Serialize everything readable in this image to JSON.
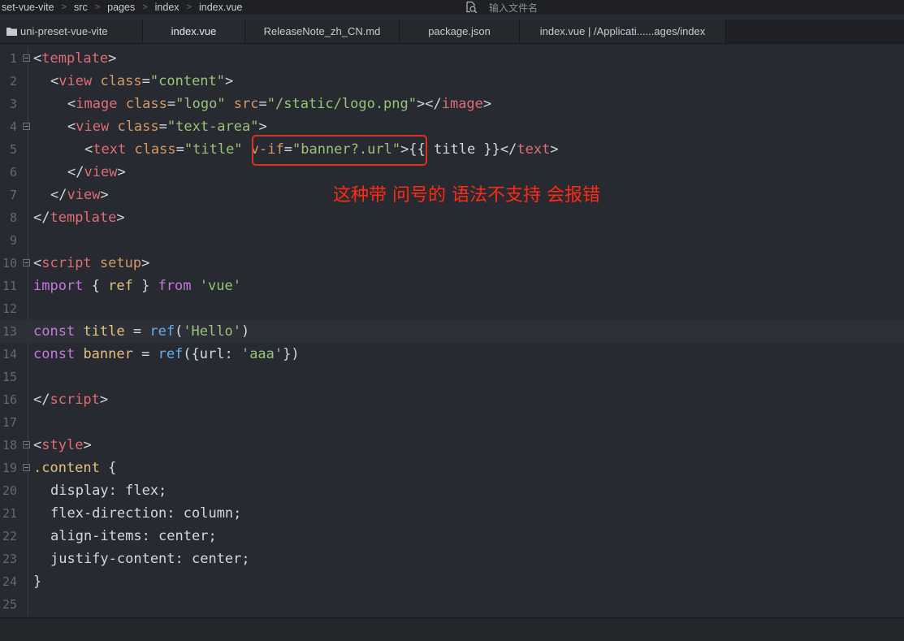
{
  "breadcrumb": [
    "set-vue-vite",
    "src",
    "pages",
    "index",
    "index.vue"
  ],
  "breadcrumb_separator": ">",
  "search": {
    "placeholder": "输入文件名"
  },
  "tabs": [
    {
      "label": "uni-preset-vue-vite",
      "active": false
    },
    {
      "label": "index.vue",
      "active": true
    },
    {
      "label": "ReleaseNote_zh_CN.md",
      "active": false
    },
    {
      "label": "package.json",
      "active": false
    },
    {
      "label": "index.vue | /Applicati......ages/index",
      "active": false
    }
  ],
  "lines": [
    {
      "n": "1",
      "fold": true,
      "indent": 0,
      "tokens": [
        [
          "p",
          "<"
        ],
        [
          "t",
          "template"
        ],
        [
          "p",
          ">"
        ]
      ]
    },
    {
      "n": "2",
      "fold": false,
      "indent": 1,
      "tokens": [
        [
          "p",
          "<"
        ],
        [
          "t",
          "view"
        ],
        [
          "p",
          " "
        ],
        [
          "a",
          "class"
        ],
        [
          "p",
          "="
        ],
        [
          "s",
          "\"content\""
        ],
        [
          "p",
          ">"
        ]
      ]
    },
    {
      "n": "3",
      "fold": false,
      "indent": 2,
      "tokens": [
        [
          "p",
          "<"
        ],
        [
          "t",
          "image"
        ],
        [
          "p",
          " "
        ],
        [
          "a",
          "class"
        ],
        [
          "p",
          "="
        ],
        [
          "s",
          "\"logo\""
        ],
        [
          "p",
          " "
        ],
        [
          "a",
          "src"
        ],
        [
          "p",
          "="
        ],
        [
          "s",
          "\"/static/logo.png\""
        ],
        [
          "p",
          "></"
        ],
        [
          "t",
          "image"
        ],
        [
          "p",
          ">"
        ]
      ]
    },
    {
      "n": "4",
      "fold": true,
      "indent": 2,
      "tokens": [
        [
          "p",
          "<"
        ],
        [
          "t",
          "view"
        ],
        [
          "p",
          " "
        ],
        [
          "a",
          "class"
        ],
        [
          "p",
          "="
        ],
        [
          "s",
          "\"text-area\""
        ],
        [
          "p",
          ">"
        ]
      ]
    },
    {
      "n": "5",
      "fold": false,
      "indent": 3,
      "tokens": [
        [
          "p",
          "<"
        ],
        [
          "t",
          "text"
        ],
        [
          "p",
          " "
        ],
        [
          "a",
          "class"
        ],
        [
          "p",
          "="
        ],
        [
          "s",
          "\"title\""
        ],
        [
          "p",
          " "
        ],
        [
          "a",
          "v-if"
        ],
        [
          "p",
          "="
        ],
        [
          "s",
          "\"banner?.url\""
        ],
        [
          "p",
          ">{{ title }}</"
        ],
        [
          "t",
          "text"
        ],
        [
          "p",
          ">"
        ]
      ]
    },
    {
      "n": "6",
      "fold": false,
      "indent": 2,
      "tokens": [
        [
          "p",
          "</"
        ],
        [
          "t",
          "view"
        ],
        [
          "p",
          ">"
        ]
      ]
    },
    {
      "n": "7",
      "fold": false,
      "indent": 1,
      "tokens": [
        [
          "p",
          "</"
        ],
        [
          "t",
          "view"
        ],
        [
          "p",
          ">"
        ]
      ]
    },
    {
      "n": "8",
      "fold": false,
      "indent": 0,
      "tokens": [
        [
          "p",
          "</"
        ],
        [
          "t",
          "template"
        ],
        [
          "p",
          ">"
        ]
      ]
    },
    {
      "n": "9",
      "fold": false,
      "indent": 0,
      "tokens": []
    },
    {
      "n": "10",
      "fold": true,
      "indent": 0,
      "tokens": [
        [
          "p",
          "<"
        ],
        [
          "t",
          "script"
        ],
        [
          "p",
          " "
        ],
        [
          "a",
          "setup"
        ],
        [
          "p",
          ">"
        ]
      ]
    },
    {
      "n": "11",
      "fold": false,
      "indent": 0,
      "tokens": [
        [
          "k",
          "import"
        ],
        [
          "p",
          " { "
        ],
        [
          "v",
          "ref"
        ],
        [
          "p",
          " } "
        ],
        [
          "k",
          "from"
        ],
        [
          "p",
          " "
        ],
        [
          "s",
          "'vue'"
        ]
      ]
    },
    {
      "n": "12",
      "fold": false,
      "indent": 0,
      "tokens": []
    },
    {
      "n": "13",
      "fold": false,
      "indent": 0,
      "current": true,
      "tokens": [
        [
          "k",
          "const"
        ],
        [
          "p",
          " "
        ],
        [
          "v",
          "title"
        ],
        [
          "p",
          " = "
        ],
        [
          "f",
          "ref"
        ],
        [
          "p",
          "("
        ],
        [
          "s",
          "'Hello'"
        ],
        [
          "p",
          ")"
        ]
      ]
    },
    {
      "n": "14",
      "fold": false,
      "indent": 0,
      "tokens": [
        [
          "k",
          "const"
        ],
        [
          "p",
          " "
        ],
        [
          "v",
          "banner"
        ],
        [
          "p",
          " = "
        ],
        [
          "f",
          "ref"
        ],
        [
          "p",
          "({url: "
        ],
        [
          "s",
          "'aaa'"
        ],
        [
          "p",
          "})"
        ]
      ]
    },
    {
      "n": "15",
      "fold": false,
      "indent": 0,
      "tokens": []
    },
    {
      "n": "16",
      "fold": false,
      "indent": 0,
      "tokens": [
        [
          "p",
          "</"
        ],
        [
          "t",
          "script"
        ],
        [
          "p",
          ">"
        ]
      ]
    },
    {
      "n": "17",
      "fold": false,
      "indent": 0,
      "tokens": []
    },
    {
      "n": "18",
      "fold": true,
      "indent": 0,
      "tokens": [
        [
          "p",
          "<"
        ],
        [
          "t",
          "style"
        ],
        [
          "p",
          ">"
        ]
      ]
    },
    {
      "n": "19",
      "fold": true,
      "indent": 0,
      "tokens": [
        [
          "sel",
          ".content"
        ],
        [
          "p",
          " {"
        ]
      ]
    },
    {
      "n": "20",
      "fold": false,
      "indent": 1,
      "tokens": [
        [
          "p",
          "display: flex;"
        ]
      ]
    },
    {
      "n": "21",
      "fold": false,
      "indent": 1,
      "tokens": [
        [
          "p",
          "flex-direction: column;"
        ]
      ]
    },
    {
      "n": "22",
      "fold": false,
      "indent": 1,
      "tokens": [
        [
          "p",
          "align-items: center;"
        ]
      ]
    },
    {
      "n": "23",
      "fold": false,
      "indent": 1,
      "tokens": [
        [
          "p",
          "justify-content: center;"
        ]
      ]
    },
    {
      "n": "24",
      "fold": false,
      "indent": 0,
      "tokens": [
        [
          "p",
          "}"
        ]
      ]
    },
    {
      "n": "25",
      "fold": false,
      "indent": 0,
      "tokens": []
    }
  ],
  "annotation": "这种带 问号的 语法不支持 会报错",
  "colors": {
    "background": "#272a30",
    "tag": "#e06c75",
    "attribute": "#d19a66",
    "string": "#98c379",
    "keyword": "#c678dd",
    "annotation": "#ff2a14"
  }
}
